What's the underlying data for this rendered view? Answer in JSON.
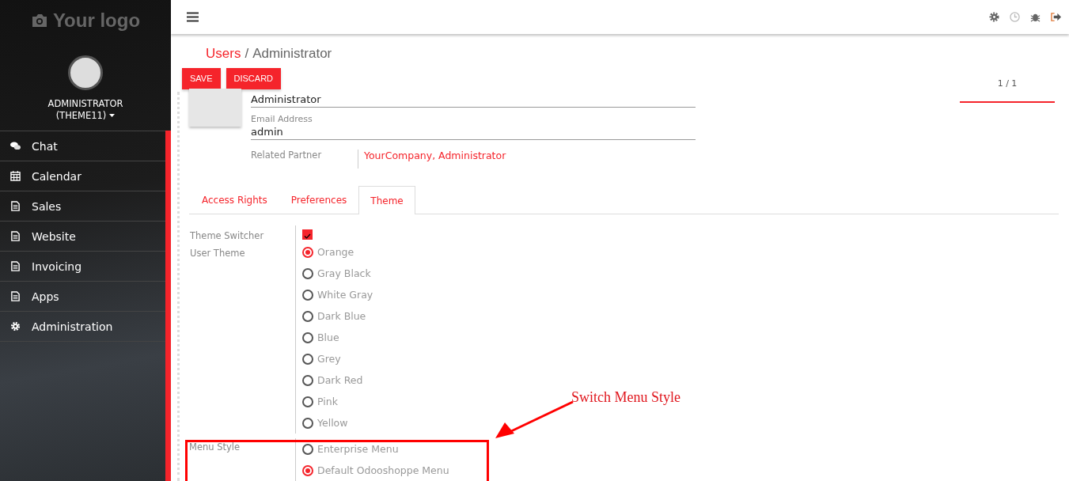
{
  "sidebar": {
    "logo": "Your logo",
    "user": "ADMINISTRATOR",
    "company": "(THEME11)",
    "items": [
      {
        "label": "Chat",
        "kind": "chat"
      },
      {
        "label": "Calendar",
        "kind": "calendar"
      },
      {
        "label": "Sales",
        "kind": "document"
      },
      {
        "label": "Website",
        "kind": "document"
      },
      {
        "label": "Invoicing",
        "kind": "document"
      },
      {
        "label": "Apps",
        "kind": "document"
      },
      {
        "label": "Administration",
        "kind": "gear"
      }
    ]
  },
  "breadcrumb": {
    "parent": "Users",
    "separator": "/",
    "current": "Administrator"
  },
  "buttons": [
    "SAVE",
    "DISCARD"
  ],
  "pager": "1 / 1",
  "form": {
    "name": "Administrator",
    "email_label": "Email Address",
    "email": "admin",
    "partner_label": "Related Partner",
    "partner": "YourCompany, Administrator"
  },
  "tabs": [
    {
      "label": "Access Rights",
      "selected": false
    },
    {
      "label": "Preferences",
      "selected": false
    },
    {
      "label": "Theme",
      "selected": true
    }
  ],
  "theme_switcher": {
    "label": "Theme Switcher",
    "checked": true
  },
  "user_theme": {
    "label": "User Theme",
    "options": [
      {
        "label": "Orange",
        "selected": true
      },
      {
        "label": "Gray Black",
        "selected": false
      },
      {
        "label": "White Gray",
        "selected": false
      },
      {
        "label": "Dark Blue",
        "selected": false
      },
      {
        "label": "Blue",
        "selected": false
      },
      {
        "label": "Grey",
        "selected": false
      },
      {
        "label": "Dark Red",
        "selected": false
      },
      {
        "label": "Pink",
        "selected": false
      },
      {
        "label": "Yellow",
        "selected": false
      }
    ]
  },
  "menu_style": {
    "label": "Menu Style",
    "options": [
      {
        "label": "Enterprise Menu",
        "selected": false
      },
      {
        "label": "Default Odooshoppe Menu",
        "selected": true
      }
    ]
  },
  "annotation": "Switch Menu Style"
}
